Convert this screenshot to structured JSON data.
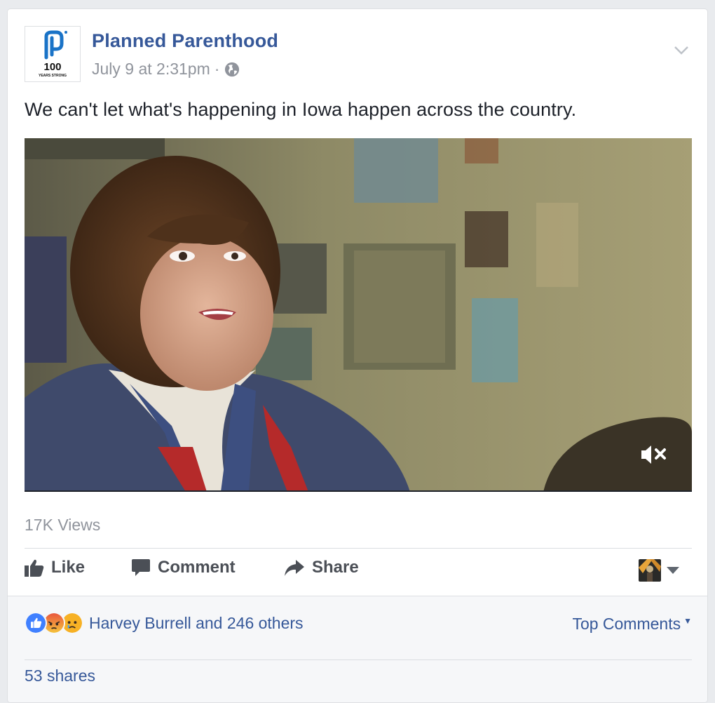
{
  "post": {
    "page_name": "Planned Parenthood",
    "timestamp": "July 9 at 2:31pm",
    "separator": "·",
    "audience_icon": "globe-icon",
    "text": "We can't let what's happening in Iowa happen across the country."
  },
  "avatar": {
    "logo_number": "100",
    "logo_tagline": "YEARS STRONG"
  },
  "video": {
    "mute_icon": "muted-speaker-icon"
  },
  "stats": {
    "views": "17K Views"
  },
  "actions": {
    "like_label": "Like",
    "comment_label": "Comment",
    "share_label": "Share"
  },
  "reactions": {
    "icons": [
      "like-reaction-icon",
      "angry-reaction-icon",
      "sad-reaction-icon"
    ],
    "summary": "Harvey Burrell and 246 others"
  },
  "comments": {
    "sort_label": "Top Comments",
    "sort_caret": "▼"
  },
  "shares": {
    "label": "53 shares"
  },
  "colors": {
    "link_blue": "#365899",
    "muted_gray": "#90949c",
    "action_gray": "#4b4f56",
    "like_blue": "#4080ff",
    "angry_red": "#e9573f",
    "sad_yellow": "#f7b125"
  }
}
